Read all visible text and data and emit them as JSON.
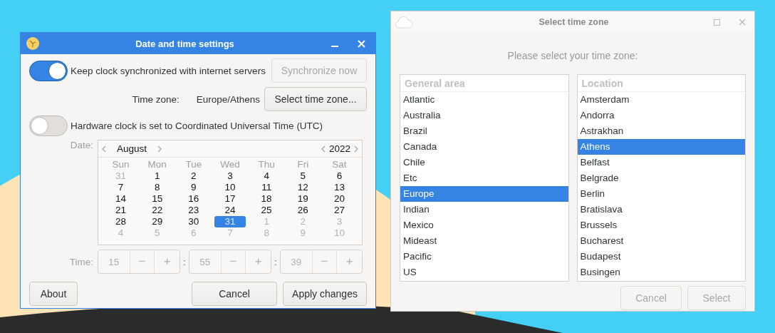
{
  "date_time_window": {
    "title": "Date and time settings",
    "sync_toggle": {
      "label": "Keep clock synchronized with internet servers",
      "on": true
    },
    "sync_button": {
      "label": "Synchronize now",
      "disabled": true
    },
    "time_zone": {
      "label": "Time zone:",
      "value": "Europe/Athens"
    },
    "select_zone_button": {
      "label": "Select time zone...",
      "disabled": false
    },
    "utc_toggle": {
      "label": "Hardware clock is set to Coordinated Universal Time (UTC)",
      "on": false
    },
    "date_label": "Date:",
    "calendar": {
      "month": "August",
      "year": "2022",
      "weekdays": [
        "Sun",
        "Mon",
        "Tue",
        "Wed",
        "Thu",
        "Fri",
        "Sat"
      ],
      "days": [
        {
          "label": "31",
          "muted": true,
          "selected": false
        },
        {
          "label": "1",
          "muted": false,
          "selected": false
        },
        {
          "label": "2",
          "muted": false,
          "selected": false
        },
        {
          "label": "3",
          "muted": false,
          "selected": false
        },
        {
          "label": "4",
          "muted": false,
          "selected": false
        },
        {
          "label": "5",
          "muted": false,
          "selected": false
        },
        {
          "label": "6",
          "muted": false,
          "selected": false
        },
        {
          "label": "7",
          "muted": false,
          "selected": false
        },
        {
          "label": "8",
          "muted": false,
          "selected": false
        },
        {
          "label": "9",
          "muted": false,
          "selected": false
        },
        {
          "label": "10",
          "muted": false,
          "selected": false
        },
        {
          "label": "11",
          "muted": false,
          "selected": false
        },
        {
          "label": "12",
          "muted": false,
          "selected": false
        },
        {
          "label": "13",
          "muted": false,
          "selected": false
        },
        {
          "label": "14",
          "muted": false,
          "selected": false
        },
        {
          "label": "15",
          "muted": false,
          "selected": false
        },
        {
          "label": "16",
          "muted": false,
          "selected": false
        },
        {
          "label": "17",
          "muted": false,
          "selected": false
        },
        {
          "label": "18",
          "muted": false,
          "selected": false
        },
        {
          "label": "19",
          "muted": false,
          "selected": false
        },
        {
          "label": "20",
          "muted": false,
          "selected": false
        },
        {
          "label": "21",
          "muted": false,
          "selected": false
        },
        {
          "label": "22",
          "muted": false,
          "selected": false
        },
        {
          "label": "23",
          "muted": false,
          "selected": false
        },
        {
          "label": "24",
          "muted": false,
          "selected": false
        },
        {
          "label": "25",
          "muted": false,
          "selected": false
        },
        {
          "label": "26",
          "muted": false,
          "selected": false
        },
        {
          "label": "27",
          "muted": false,
          "selected": false
        },
        {
          "label": "28",
          "muted": false,
          "selected": false
        },
        {
          "label": "29",
          "muted": false,
          "selected": false
        },
        {
          "label": "30",
          "muted": false,
          "selected": false
        },
        {
          "label": "31",
          "muted": false,
          "selected": true
        },
        {
          "label": "1",
          "muted": true,
          "selected": false
        },
        {
          "label": "2",
          "muted": true,
          "selected": false
        },
        {
          "label": "3",
          "muted": true,
          "selected": false
        },
        {
          "label": "4",
          "muted": true,
          "selected": false
        },
        {
          "label": "5",
          "muted": true,
          "selected": false
        },
        {
          "label": "6",
          "muted": true,
          "selected": false
        },
        {
          "label": "7",
          "muted": true,
          "selected": false
        },
        {
          "label": "8",
          "muted": true,
          "selected": false
        },
        {
          "label": "9",
          "muted": true,
          "selected": false
        },
        {
          "label": "10",
          "muted": true,
          "selected": false
        }
      ]
    },
    "time_label": "Time:",
    "time": [
      {
        "value": "15",
        "minus": "−",
        "plus": "+",
        "disabled": true
      },
      {
        "value": "55",
        "minus": "−",
        "plus": "+",
        "disabled": true
      },
      {
        "value": "39",
        "minus": "−",
        "plus": "+",
        "disabled": true
      }
    ],
    "separators": [
      ":",
      ":"
    ],
    "about_button": {
      "label": "About",
      "disabled": false
    },
    "cancel_button": {
      "label": "Cancel",
      "disabled": false
    },
    "apply_button": {
      "label": "Apply changes",
      "disabled": false
    }
  },
  "time_zone_window": {
    "title": "Select time zone",
    "prompt": "Please select your time zone:",
    "areas": {
      "header": "General area",
      "items": [
        {
          "label": "Atlantic",
          "selected": false
        },
        {
          "label": "Australia",
          "selected": false
        },
        {
          "label": "Brazil",
          "selected": false
        },
        {
          "label": "Canada",
          "selected": false
        },
        {
          "label": "Chile",
          "selected": false
        },
        {
          "label": "Etc",
          "selected": false
        },
        {
          "label": "Europe",
          "selected": true
        },
        {
          "label": "Indian",
          "selected": false
        },
        {
          "label": "Mexico",
          "selected": false
        },
        {
          "label": "Mideast",
          "selected": false
        },
        {
          "label": "Pacific",
          "selected": false
        },
        {
          "label": "US",
          "selected": false
        }
      ]
    },
    "locations": {
      "header": "Location",
      "items": [
        {
          "label": "Amsterdam",
          "selected": false
        },
        {
          "label": "Andorra",
          "selected": false
        },
        {
          "label": "Astrakhan",
          "selected": false
        },
        {
          "label": "Athens",
          "selected": true
        },
        {
          "label": "Belfast",
          "selected": false
        },
        {
          "label": "Belgrade",
          "selected": false
        },
        {
          "label": "Berlin",
          "selected": false
        },
        {
          "label": "Bratislava",
          "selected": false
        },
        {
          "label": "Brussels",
          "selected": false
        },
        {
          "label": "Bucharest",
          "selected": false
        },
        {
          "label": "Budapest",
          "selected": false
        },
        {
          "label": "Busingen",
          "selected": false
        }
      ]
    },
    "buttons": [
      {
        "label": "Cancel",
        "disabled": true
      },
      {
        "label": "Select",
        "disabled": true
      }
    ]
  }
}
